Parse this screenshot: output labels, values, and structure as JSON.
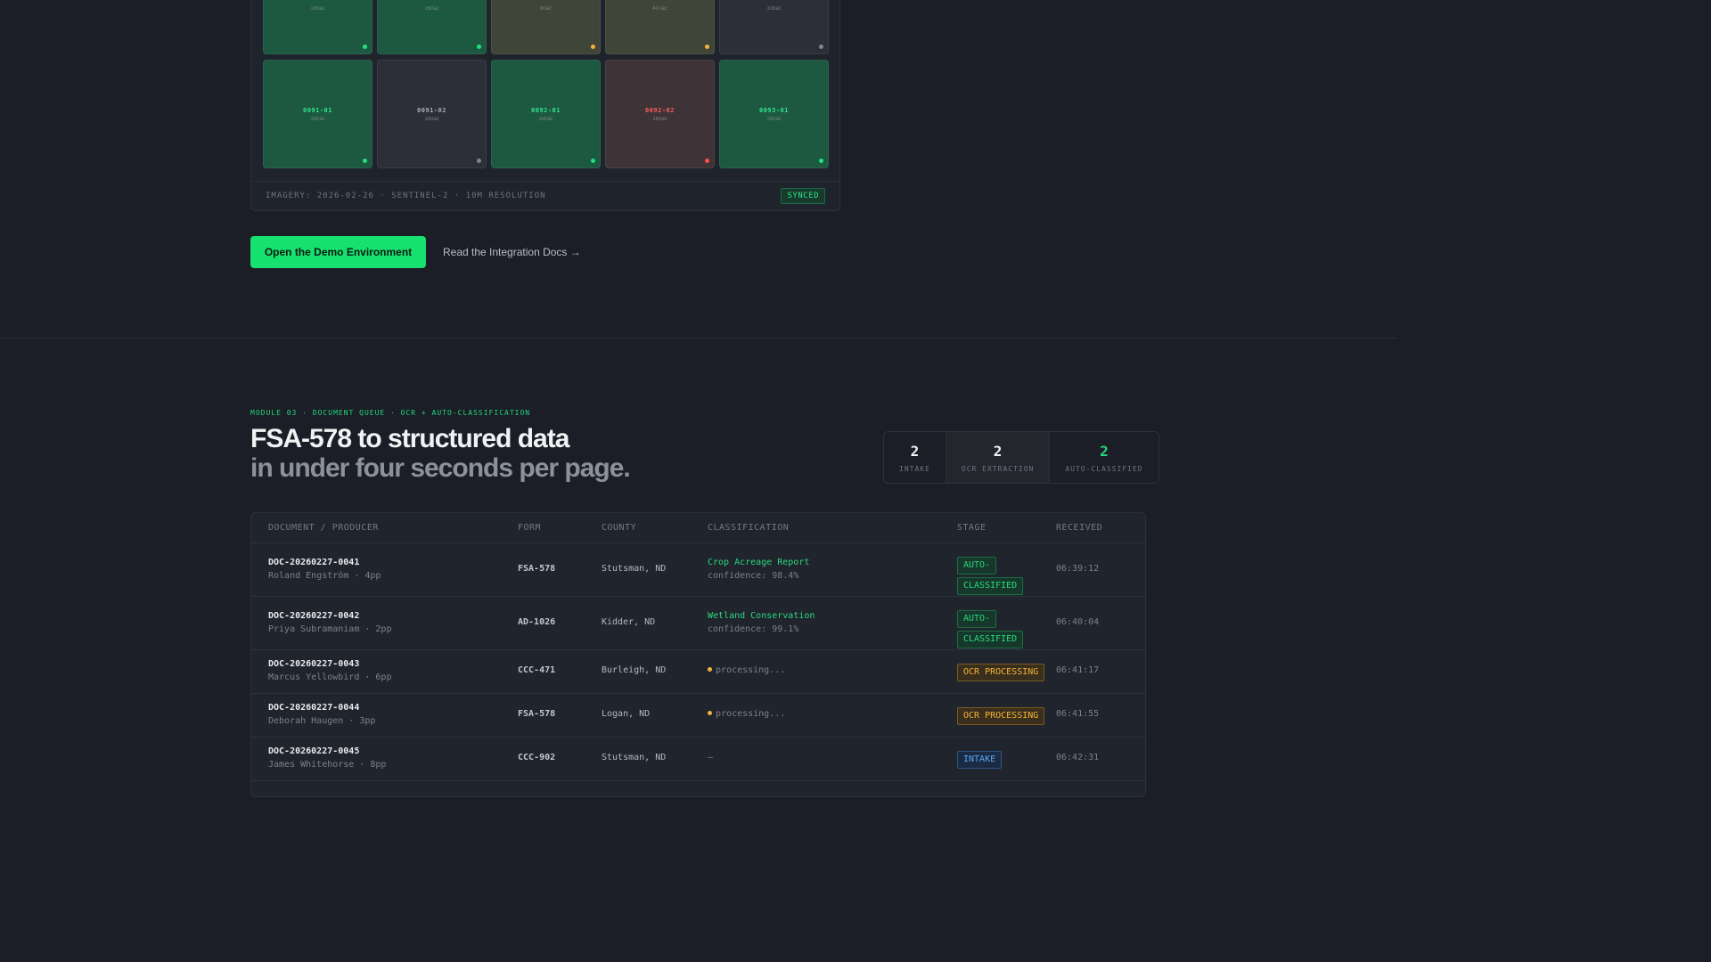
{
  "map": {
    "tiles_row1": [
      {
        "id": "",
        "sub": "180ac",
        "status": "green"
      },
      {
        "id": "",
        "sub": "160ac",
        "status": "green"
      },
      {
        "id": "",
        "sub": "80ac",
        "status": "yellow"
      },
      {
        "id": "",
        "sub": "407ac",
        "status": "yellow"
      },
      {
        "id": "",
        "sub": "108ac",
        "status": "gray"
      }
    ],
    "tiles_row2": [
      {
        "id": "0091-01",
        "sub": "160ac",
        "status": "green"
      },
      {
        "id": "0091-02",
        "sub": "160ac",
        "status": "gray"
      },
      {
        "id": "0092-01",
        "sub": "160ac",
        "status": "green"
      },
      {
        "id": "0092-02",
        "sub": "160ac",
        "status": "red"
      },
      {
        "id": "0093-01",
        "sub": "160ac",
        "status": "green"
      }
    ],
    "footer_meta": "IMAGERY: 2026-02-26 · SENTINEL-2 · 10M RESOLUTION",
    "sync_status": "SYNCED"
  },
  "cta": {
    "primary": "Open the Demo Environment",
    "secondary": "Read the Integration Docs →"
  },
  "module": {
    "eyebrow": "MODULE 03 · DOCUMENT QUEUE · OCR + AUTO-CLASSIFICATION",
    "title_line1": "FSA-578 to structured data",
    "title_line2": "in under four seconds per page.",
    "stats": [
      {
        "value": "2",
        "label": "INTAKE"
      },
      {
        "value": "2",
        "label": "OCR EXTRACTION"
      },
      {
        "value": "2",
        "label": "AUTO-CLASSIFIED"
      }
    ]
  },
  "table": {
    "headers": [
      "DOCUMENT / PRODUCER",
      "FORM",
      "COUNTY",
      "CLASSIFICATION",
      "STAGE",
      "RECEIVED"
    ],
    "rows": [
      {
        "doc": "DOC-20260227-0041",
        "producer": "Roland Engström · 4pp",
        "form": "FSA-578",
        "county": "Stutsman, ND",
        "classification": "Crop Acreage Report",
        "confidence": "confidence: 98.4%",
        "stage_l1": "AUTO-",
        "stage_l2": "CLASSIFIED",
        "received": "06:39:12"
      },
      {
        "doc": "DOC-20260227-0042",
        "producer": "Priya Subramaniam · 2pp",
        "form": "AD-1026",
        "county": "Kidder, ND",
        "classification": "Wetland Conservation",
        "confidence": "confidence: 99.1%",
        "stage_l1": "AUTO-",
        "stage_l2": "CLASSIFIED",
        "received": "06:40:04"
      },
      {
        "doc": "DOC-20260227-0043",
        "producer": "Marcus Yellowbird · 6pp",
        "form": "CCC-471",
        "county": "Burleigh, ND",
        "processing": "processing...",
        "stage": "OCR PROCESSING",
        "received": "06:41:17"
      },
      {
        "doc": "DOC-20260227-0044",
        "producer": "Deborah Haugen · 3pp",
        "form": "FSA-578",
        "county": "Logan, ND",
        "processing": "processing...",
        "stage": "OCR PROCESSING",
        "received": "06:41:55"
      },
      {
        "doc": "DOC-20260227-0045",
        "producer": "James Whitehorse · 8pp",
        "form": "CCC-902",
        "county": "Stutsman, ND",
        "processing": "—",
        "stage": "INTAKE",
        "received": "06:42:31"
      }
    ]
  }
}
